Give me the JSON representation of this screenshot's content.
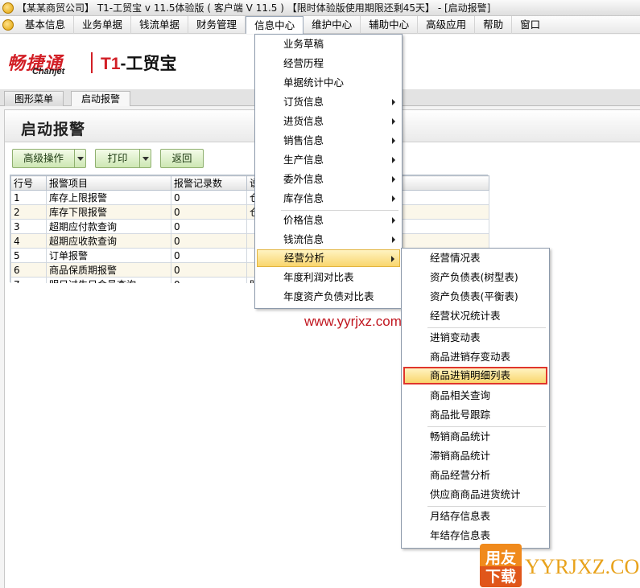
{
  "window": {
    "title": "【某某商贸公司】 T1-工贸宝 v 11.5体验版 ( 客户端 V 11.5 ) 【限时体验版使用期限还剩45天】 - [启动报警]"
  },
  "menubar": [
    "基本信息",
    "业务单据",
    "钱流单据",
    "财务管理",
    "信息中心",
    "维护中心",
    "辅助中心",
    "高级应用",
    "帮助",
    "窗口"
  ],
  "brand": {
    "name_cn": "畅捷通",
    "name_en": "Chanjet",
    "product_prefix": "T1",
    "product_suffix": "-工贸宝"
  },
  "tabs": [
    "图形菜单",
    "启动报警"
  ],
  "page": {
    "title": "启动报警"
  },
  "toolbar": {
    "advanced": "高级操作",
    "print": "打印",
    "back": "返回"
  },
  "table": {
    "columns": [
      "行号",
      "报警项目",
      "报警记录数",
      "说"
    ],
    "rows": [
      [
        "1",
        "库存上限报警",
        "0",
        "仓"
      ],
      [
        "2",
        "库存下限报警",
        "0",
        "仓"
      ],
      [
        "3",
        "超期应付款查询",
        "0",
        ""
      ],
      [
        "4",
        "超期应收款查询",
        "0",
        ""
      ],
      [
        "5",
        "订单报警",
        "0",
        ""
      ],
      [
        "6",
        "商品保质期报警",
        "0",
        ""
      ],
      [
        "7",
        "明日过生日会员查询",
        "0",
        "明"
      ]
    ]
  },
  "info_menu": [
    {
      "label": "业务草稿",
      "sub": false
    },
    {
      "label": "经营历程",
      "sub": false
    },
    {
      "label": "单据统计中心",
      "sub": false
    },
    {
      "label": "订货信息",
      "sub": true
    },
    {
      "label": "进货信息",
      "sub": true
    },
    {
      "label": "销售信息",
      "sub": true
    },
    {
      "label": "生产信息",
      "sub": true
    },
    {
      "label": "委外信息",
      "sub": true
    },
    {
      "label": "库存信息",
      "sub": true
    },
    {
      "label": "价格信息",
      "sub": true
    },
    {
      "label": "钱流信息",
      "sub": true
    },
    {
      "label": "经营分析",
      "sub": true
    },
    {
      "label": "年度利润对比表",
      "sub": false
    },
    {
      "label": "年度资产负债对比表",
      "sub": false
    }
  ],
  "analysis_menu": [
    "经营情况表",
    "资产负债表(树型表)",
    "资产负债表(平衡表)",
    "经营状况统计表",
    "进销变动表",
    "商品进销存变动表",
    "商品进销明细列表",
    "商品相关查询",
    "商品批号跟踪",
    "畅销商品统计",
    "滞销商品统计",
    "商品经营分析",
    "供应商商品进货统计",
    "月结存信息表",
    "年结存信息表"
  ],
  "watermark": {
    "url": "www.yyrjxz.com",
    "badge_top": "用友",
    "badge_bottom": "下载",
    "site": "YYRJXZ.COM"
  },
  "colors": {
    "accent_red": "#d21f26",
    "highlight": "#f9d66d",
    "button_green": "#cde7b3",
    "badge_orange": "#f08a1c"
  }
}
